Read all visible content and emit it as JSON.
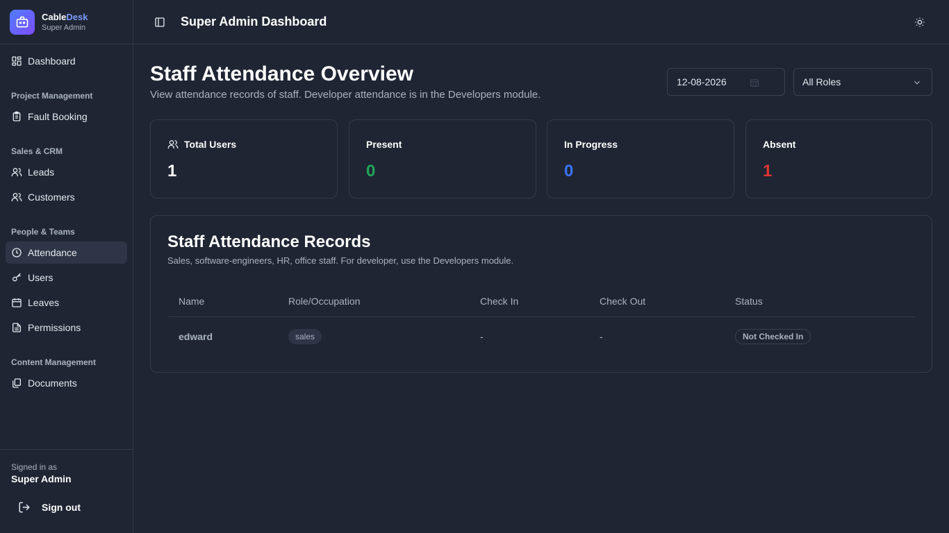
{
  "brand": {
    "name_part1": "Cable",
    "name_part2": "Desk",
    "subtitle": "Super Admin"
  },
  "sidebar": {
    "dashboard": "Dashboard",
    "sections": {
      "project": "Project Management",
      "sales": "Sales & CRM",
      "people": "People & Teams",
      "content": "Content Management"
    },
    "items": {
      "fault_booking": "Fault Booking",
      "leads": "Leads",
      "customers": "Customers",
      "attendance": "Attendance",
      "users": "Users",
      "leaves": "Leaves",
      "permissions": "Permissions",
      "documents": "Documents"
    },
    "footer": {
      "signed_label": "Signed in as",
      "signed_name": "Super Admin",
      "signout": "Sign out"
    }
  },
  "topbar": {
    "title": "Super Admin Dashboard"
  },
  "page": {
    "title": "Staff Attendance Overview",
    "description": "View attendance records of staff. Developer attendance is in the Developers module.",
    "date_value": "12-08-2026",
    "role_filter": "All Roles"
  },
  "stats": [
    {
      "label": "Total Users",
      "value": "1",
      "color": "#ffffff"
    },
    {
      "label": "Present",
      "value": "0",
      "color": "#22a55a"
    },
    {
      "label": "In Progress",
      "value": "0",
      "color": "#3b74f6"
    },
    {
      "label": "Absent",
      "value": "1",
      "color": "#e03535"
    }
  ],
  "records": {
    "title": "Staff Attendance Records",
    "description": "Sales, software-engineers, HR, office staff. For developer, use the Developers module.",
    "columns": [
      "Name",
      "Role/Occupation",
      "Check In",
      "Check Out",
      "Status"
    ],
    "rows": [
      {
        "name": "edward",
        "role": "sales",
        "check_in": "-",
        "check_out": "-",
        "status": "Not Checked In"
      }
    ]
  }
}
